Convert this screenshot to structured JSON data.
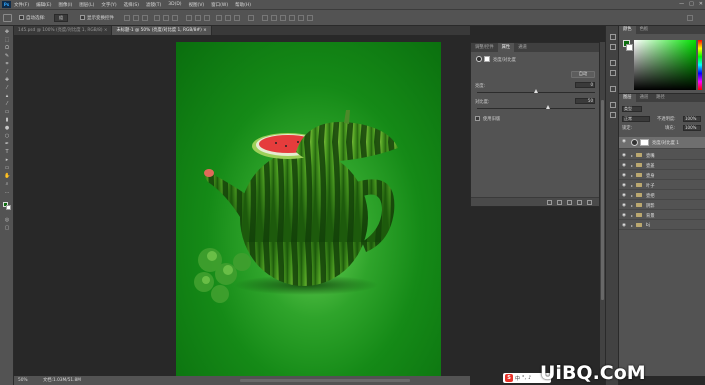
{
  "app": {
    "logo": "Ps"
  },
  "menu": [
    "文件(F)",
    "编辑(E)",
    "图像(I)",
    "图层(L)",
    "文字(Y)",
    "选择(S)",
    "滤镜(T)",
    "3D(D)",
    "视图(V)",
    "窗口(W)",
    "帮助(H)"
  ],
  "window_controls": {
    "minimize": "—",
    "maximize": "□",
    "close": "✕"
  },
  "options_bar": {
    "auto_select_label": "自动选择:",
    "auto_select_value": "组",
    "show_transform_label": "显示变换控件"
  },
  "doc_tabs": [
    {
      "label": "145.psd @ 100% (亮度/对比度 1, RGB/8) ×",
      "active": false
    },
    {
      "label": "未标题-1 @ 50% (亮度/对比度 1, RGB/8#) ×",
      "active": true
    }
  ],
  "status_bar": {
    "zoom": "50%",
    "doc": "文档:1.03M/51.8M"
  },
  "properties": {
    "tabs": [
      "调整/控件",
      "属性",
      "通道"
    ],
    "active_tab": "属性",
    "panel_title": "亮度/对比度",
    "auto_button": "自动",
    "brightness_label": "亮度:",
    "brightness_value": "0",
    "brightness_level": 0.5,
    "contrast_label": "对比度:",
    "contrast_value": "50",
    "contrast_level": 0.6,
    "legacy_label": "使用旧版"
  },
  "color_panel": {
    "tabs": [
      "颜色",
      "色板"
    ],
    "foreground": "#0d6e10",
    "background": "#ffffff"
  },
  "layers_panel": {
    "tabs": [
      "图层",
      "通道",
      "路径"
    ],
    "kind_label": "类型",
    "blend_mode": "正常",
    "opacity_label": "不透明度:",
    "opacity_value": "100%",
    "lock_label": "锁定:",
    "fill_label": "填充:",
    "fill_value": "100%",
    "selected_layer": "亮度/对比度 1",
    "groups": [
      "壶嘴",
      "壶盖",
      "壶身",
      "叶子",
      "壶把",
      "阴影",
      "背景",
      "bj"
    ]
  },
  "watermark": "UiBQ.CoM",
  "ime": {
    "logo": "S",
    "label": "中"
  }
}
